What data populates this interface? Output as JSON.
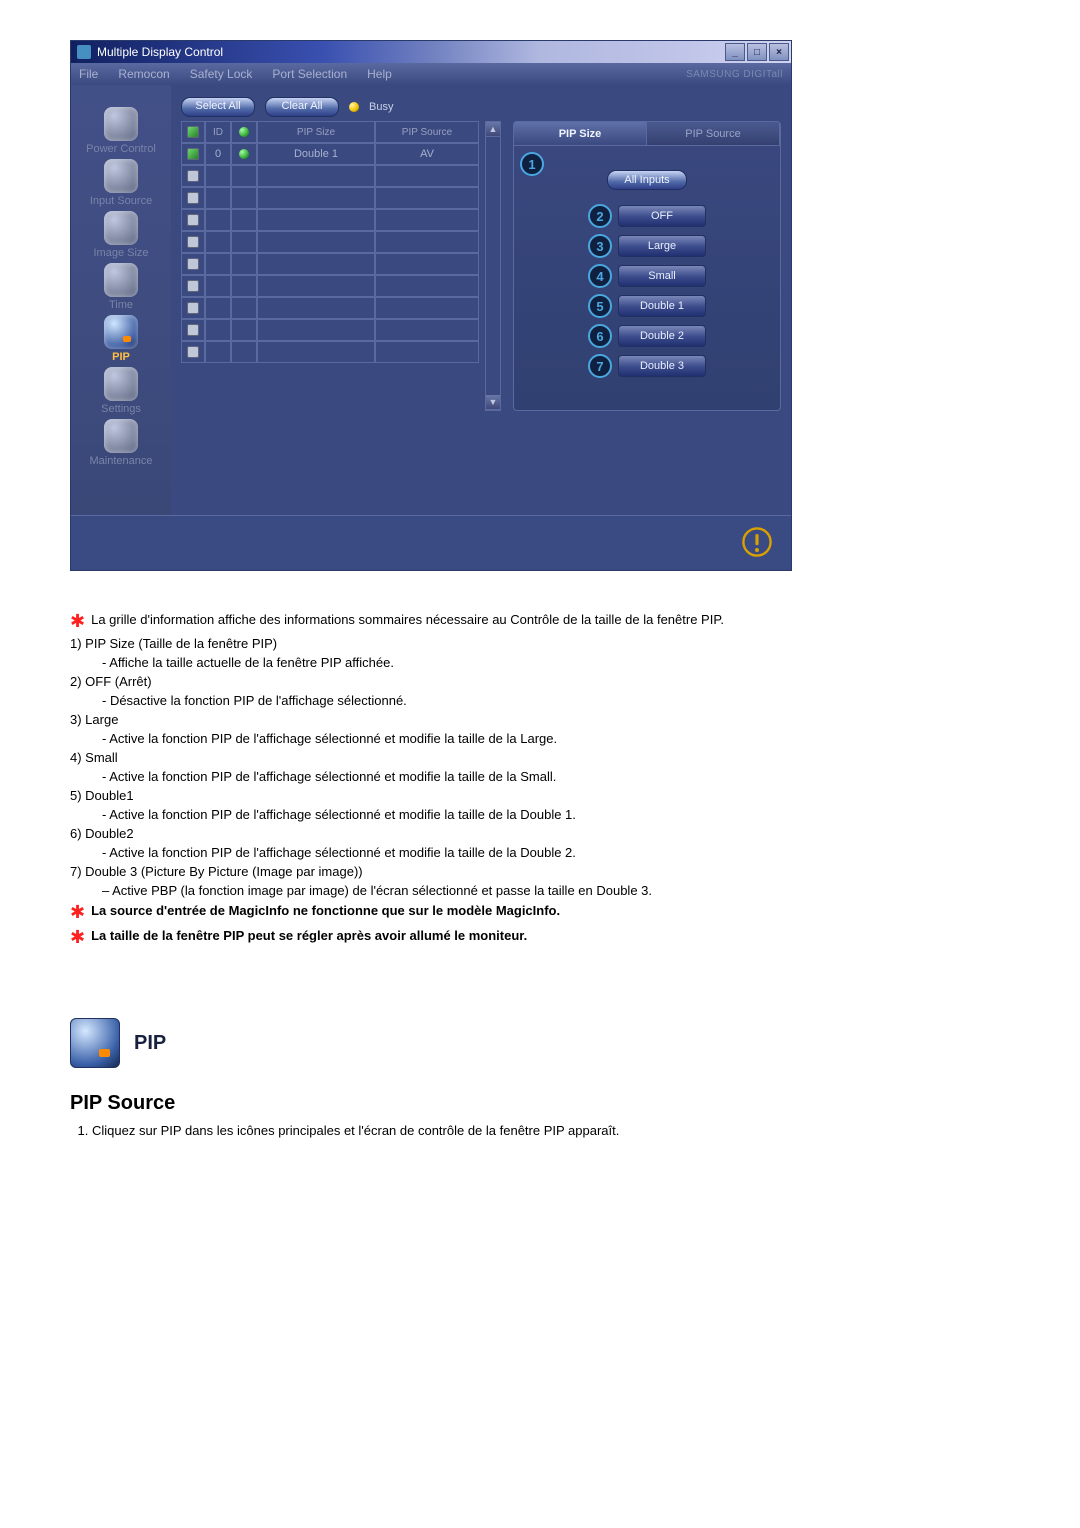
{
  "window": {
    "title": "Multiple Display Control"
  },
  "menubar": {
    "items": [
      "File",
      "Remocon",
      "Safety Lock",
      "Port Selection",
      "Help"
    ],
    "brand": "SAMSUNG DIGITall"
  },
  "controls": {
    "select_all": "Select All",
    "clear_all": "Clear All",
    "busy_label": "Busy"
  },
  "sidebar": {
    "items": [
      {
        "label": "Power Control"
      },
      {
        "label": "Input Source"
      },
      {
        "label": "Image Size"
      },
      {
        "label": "Time"
      },
      {
        "label": "PIP",
        "cls": "pip"
      },
      {
        "label": "Settings"
      },
      {
        "label": "Maintenance"
      }
    ]
  },
  "grid": {
    "headers": {
      "id": "ID",
      "pip_size": "PIP Size",
      "pip_source": "PIP Source"
    },
    "row0": {
      "id": "0",
      "pip_size": "Double 1",
      "pip_source": "AV"
    }
  },
  "right_panel": {
    "tab_size": "PIP Size",
    "tab_source": "PIP Source",
    "all_inputs": "All Inputs",
    "options": [
      {
        "n": "2",
        "label": "OFF"
      },
      {
        "n": "3",
        "label": "Large"
      },
      {
        "n": "4",
        "label": "Small"
      },
      {
        "n": "5",
        "label": "Double 1"
      },
      {
        "n": "6",
        "label": "Double 2"
      },
      {
        "n": "7",
        "label": "Double 3"
      }
    ],
    "callout1": "1"
  },
  "doc": {
    "intro": "La grille d'information affiche des informations sommaires nécessaire au Contrôle de la taille de la fenêtre PIP.",
    "items": [
      {
        "head": "1)  PIP Size (Taille de la fenêtre PIP)",
        "desc": "- Affiche la taille actuelle de la fenêtre PIP affichée."
      },
      {
        "head": "2)  OFF (Arrêt)",
        "desc": "- Désactive la fonction PIP de l'affichage sélectionné."
      },
      {
        "head": "3)  Large",
        "desc": "- Active la fonction PIP de l'affichage sélectionné et modifie la taille de la Large."
      },
      {
        "head": "4)  Small",
        "desc": "- Active la fonction PIP de l'affichage sélectionné et modifie la taille de la Small."
      },
      {
        "head": "5)  Double1",
        "desc": "- Active la fonction PIP de l'affichage sélectionné et modifie la taille de la Double 1."
      },
      {
        "head": "6)  Double2",
        "desc": "- Active la fonction PIP de l'affichage sélectionné et modifie la taille de la Double 2."
      },
      {
        "head": "7)  Double 3 (Picture By Picture (Image par image))",
        "desc": "– Active PBP (la fonction image par image) de l'écran sélectionné et passe la taille en Double 3."
      }
    ],
    "note1": "La source d'entrée de MagicInfo ne fonctionne que sur le modèle MagicInfo.",
    "note2": "La taille de la fenêtre PIP peut se régler après avoir allumé le moniteur.",
    "pip_title": "PIP",
    "sub_head": "PIP Source",
    "sub_step1": "Cliquez sur PIP dans les icônes principales et l'écran de contrôle de la fenêtre PIP apparaît."
  }
}
